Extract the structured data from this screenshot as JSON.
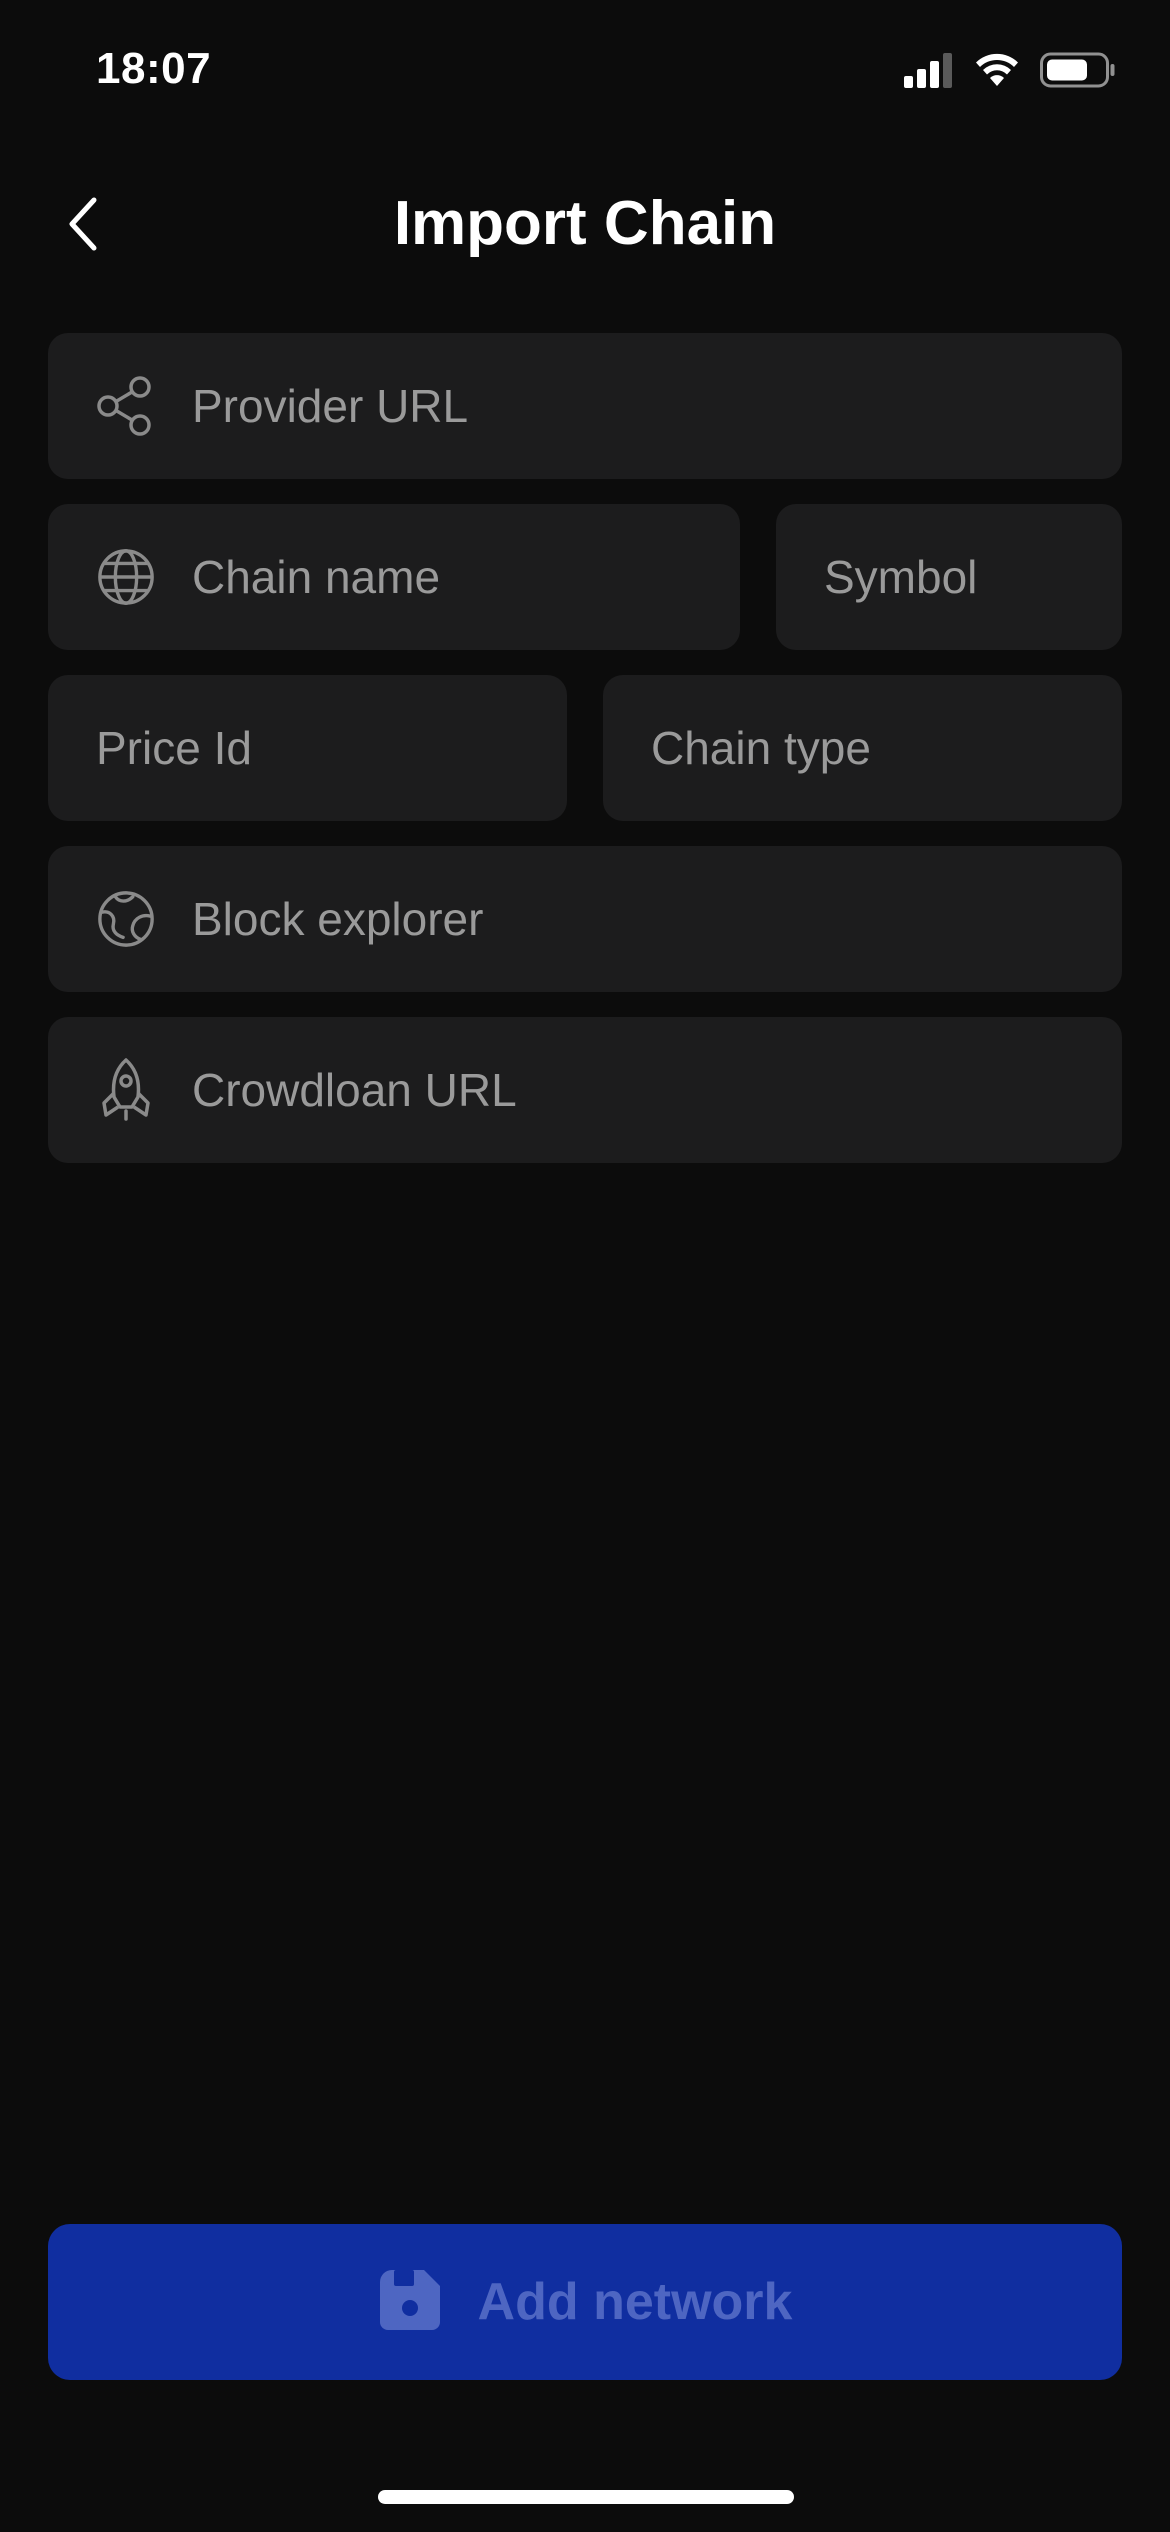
{
  "status_bar": {
    "time": "18:07"
  },
  "header": {
    "title": "Import Chain"
  },
  "form": {
    "provider_url": {
      "placeholder": "Provider URL",
      "value": "",
      "icon": "share-icon"
    },
    "chain_name": {
      "placeholder": "Chain name",
      "value": "",
      "icon": "globe-icon"
    },
    "symbol": {
      "placeholder": "Symbol",
      "value": ""
    },
    "price_id": {
      "placeholder": "Price Id",
      "value": ""
    },
    "chain_type": {
      "placeholder": "Chain type",
      "value": ""
    },
    "block_explorer": {
      "placeholder": "Block explorer",
      "value": "",
      "icon": "planet-icon"
    },
    "crowdloan_url": {
      "placeholder": "Crowdloan URL",
      "value": "",
      "icon": "rocket-icon"
    }
  },
  "actions": {
    "add_network_label": "Add network",
    "add_network_icon": "floppy-disk-icon"
  },
  "colors": {
    "background": "#0c0c0c",
    "field_background": "#1c1c1d",
    "placeholder": "#9a9a9a",
    "button_background": "#102ea0",
    "button_text": "#4e66c2"
  }
}
